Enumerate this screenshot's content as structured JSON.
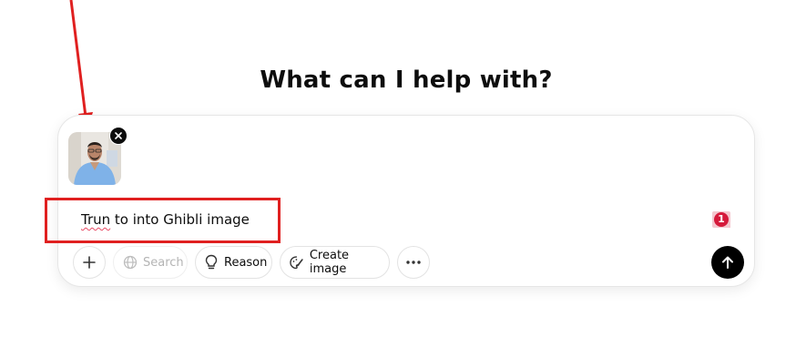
{
  "heading": "What can I help with?",
  "composer": {
    "prompt_misspelled_word": "Trun",
    "prompt_rest": " to into Ghibli image",
    "attachment": {
      "type": "image",
      "remove_icon": "close-icon"
    },
    "grammar_badge_count": "1",
    "toolbar": {
      "plus_icon": "plus-icon",
      "search_label": "Search",
      "reason_label": "Reason",
      "create_image_label": "Create image",
      "more_icon": "more-horizontal-icon"
    },
    "send_icon": "arrow-up-icon"
  },
  "annotations": {
    "arrow_color": "#e02020",
    "box_color": "#e02020"
  }
}
